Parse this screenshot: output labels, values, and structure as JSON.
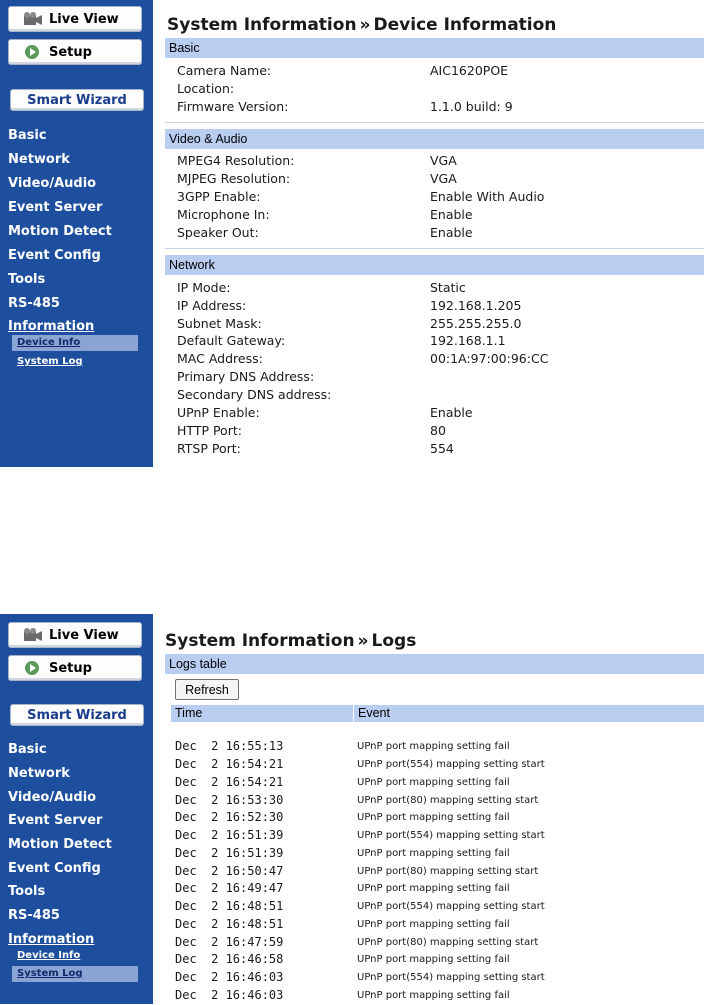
{
  "colors": {
    "sidebar": "#1e4f9e",
    "section_header": "#b8cdf0",
    "active_sub": "#8aa4d4"
  },
  "sidebar": {
    "live_view": "Live View",
    "setup": "Setup",
    "smart_wizard": "Smart Wizard",
    "nav": [
      "Basic",
      "Network",
      "Video/Audio",
      "Event Server",
      "Motion Detect",
      "Event Config",
      "Tools",
      "RS-485"
    ],
    "information": "Information",
    "sub": [
      "Device Info",
      "System Log"
    ]
  },
  "device": {
    "title_left": "System Information",
    "separator": "»",
    "title_right": "Device Information",
    "sections": [
      {
        "header": "Basic",
        "rows": [
          {
            "label": "Camera Name:",
            "value": "AIC1620POE"
          },
          {
            "label": "Location:",
            "value": ""
          },
          {
            "label": "Firmware Version:",
            "value": "1.1.0 build: 9"
          }
        ]
      },
      {
        "header": "Video & Audio",
        "rows": [
          {
            "label": "MPEG4 Resolution:",
            "value": "VGA"
          },
          {
            "label": "MJPEG Resolution:",
            "value": "VGA"
          },
          {
            "label": "3GPP Enable:",
            "value": "Enable With Audio"
          },
          {
            "label": "Microphone In:",
            "value": "Enable"
          },
          {
            "label": "Speaker Out:",
            "value": "Enable"
          }
        ]
      },
      {
        "header": "Network",
        "rows": [
          {
            "label": "IP Mode:",
            "value": "Static"
          },
          {
            "label": "IP Address:",
            "value": "192.168.1.205"
          },
          {
            "label": "Subnet Mask:",
            "value": "255.255.255.0"
          },
          {
            "label": "Default Gateway:",
            "value": "192.168.1.1"
          },
          {
            "label": "MAC Address:",
            "value": "00:1A:97:00:96:CC"
          },
          {
            "label": "Primary DNS Address:",
            "value": ""
          },
          {
            "label": "Secondary DNS address:",
            "value": ""
          },
          {
            "label": "UPnP Enable:",
            "value": "Enable"
          },
          {
            "label": "HTTP Port:",
            "value": "80"
          },
          {
            "label": "RTSP Port:",
            "value": "554"
          }
        ]
      }
    ]
  },
  "logs": {
    "title_left": "System Information",
    "separator": "»",
    "title_right": "Logs",
    "table_header": "Logs table",
    "refresh": "Refresh",
    "col_time": "Time",
    "col_event": "Event",
    "rows": [
      {
        "time": "Dec  2 16:55:13",
        "event": "UPnP port mapping setting fail"
      },
      {
        "time": "Dec  2 16:54:21",
        "event": "UPnP port(554) mapping setting start"
      },
      {
        "time": "Dec  2 16:54:21",
        "event": "UPnP port mapping setting fail"
      },
      {
        "time": "Dec  2 16:53:30",
        "event": "UPnP port(80) mapping setting start"
      },
      {
        "time": "Dec  2 16:52:30",
        "event": "UPnP port mapping setting fail"
      },
      {
        "time": "Dec  2 16:51:39",
        "event": "UPnP port(554) mapping setting start"
      },
      {
        "time": "Dec  2 16:51:39",
        "event": "UPnP port mapping setting fail"
      },
      {
        "time": "Dec  2 16:50:47",
        "event": "UPnP port(80) mapping setting start"
      },
      {
        "time": "Dec  2 16:49:47",
        "event": "UPnP port mapping setting fail"
      },
      {
        "time": "Dec  2 16:48:51",
        "event": "UPnP port(554) mapping setting start"
      },
      {
        "time": "Dec  2 16:48:51",
        "event": "UPnP port mapping setting fail"
      },
      {
        "time": "Dec  2 16:47:59",
        "event": "UPnP port(80) mapping setting start"
      },
      {
        "time": "Dec  2 16:46:58",
        "event": "UPnP port mapping setting fail"
      },
      {
        "time": "Dec  2 16:46:03",
        "event": "UPnP port(554) mapping setting start"
      },
      {
        "time": "Dec  2 16:46:03",
        "event": "UPnP port mapping setting fail"
      }
    ]
  }
}
